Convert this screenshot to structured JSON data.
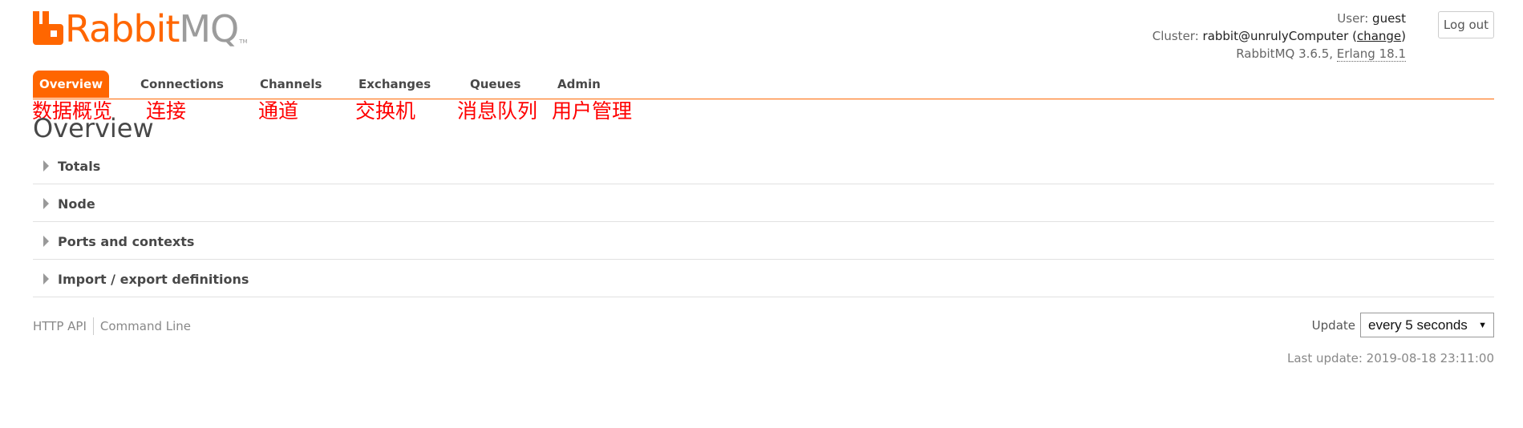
{
  "logo": {
    "brand_primary": "Rabbit",
    "brand_secondary": "MQ",
    "trademark": "TM"
  },
  "header": {
    "user_label": "User:",
    "user_value": "guest",
    "cluster_label": "Cluster:",
    "cluster_value": "rabbit@unrulyComputer",
    "cluster_change_prefix": "(",
    "cluster_change_link": "change",
    "cluster_change_suffix": ")",
    "version_text": "RabbitMQ 3.6.5,",
    "erlang_text": "Erlang 18.1",
    "logout_label": "Log out"
  },
  "tabs": [
    {
      "label": "Overview",
      "active": true
    },
    {
      "label": "Connections"
    },
    {
      "label": "Channels"
    },
    {
      "label": "Exchanges"
    },
    {
      "label": "Queues"
    },
    {
      "label": "Admin"
    }
  ],
  "annotations": [
    "数据概览",
    "连接",
    "通道",
    "交换机",
    "消息队列",
    "用户管理"
  ],
  "page_title": "Overview",
  "sections": [
    {
      "label": "Totals"
    },
    {
      "label": "Node"
    },
    {
      "label": "Ports and contexts"
    },
    {
      "label": "Import / export definitions"
    }
  ],
  "footer": {
    "http_api_link": "HTTP API",
    "command_line_link": "Command Line",
    "update_label": "Update",
    "update_selected": "every 5 seconds",
    "last_update": "Last update: 2019-08-18 23:11:00"
  },
  "colors": {
    "accent": "#ff6600",
    "annotation": "#ff0000"
  },
  "icons": [
    "rabbitmq-logo-icon",
    "expand-triangle-icon",
    "dropdown-caret-icon"
  ]
}
